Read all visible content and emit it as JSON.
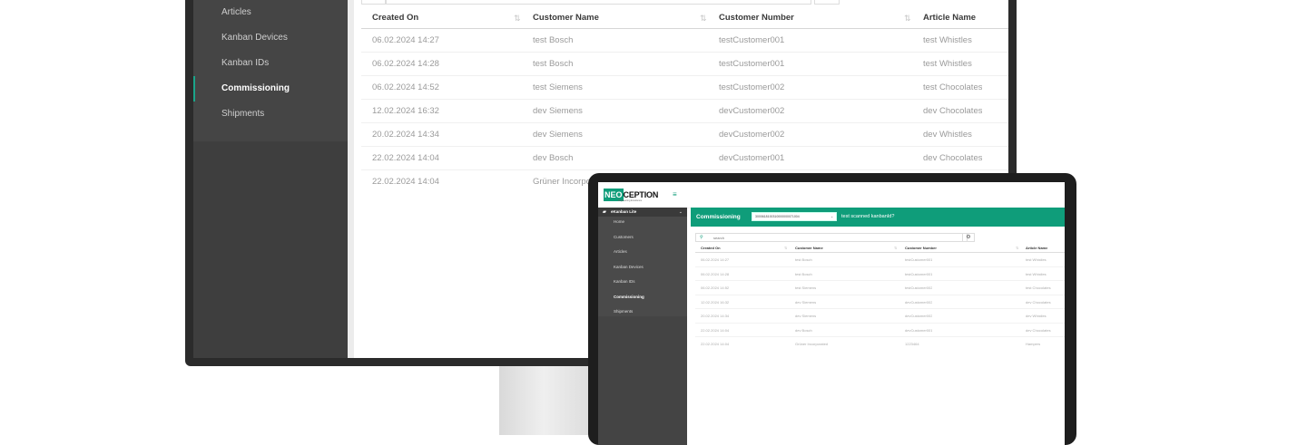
{
  "monitor": {
    "sidebar": {
      "items": [
        {
          "label": "Articles",
          "active": false
        },
        {
          "label": "Kanban Devices",
          "active": false
        },
        {
          "label": "Kanban IDs",
          "active": false
        },
        {
          "label": "Commissioning",
          "active": true
        },
        {
          "label": "Shipments",
          "active": false
        }
      ]
    },
    "table": {
      "columns": [
        "Created On",
        "Customer Name",
        "Customer Number",
        "Article Name"
      ],
      "rows": [
        [
          "06.02.2024 14:27",
          "test Bosch",
          "testCustomer001",
          "test Whistles"
        ],
        [
          "06.02.2024 14:28",
          "test Bosch",
          "testCustomer001",
          "test Whistles"
        ],
        [
          "06.02.2024 14:52",
          "test Siemens",
          "testCustomer002",
          "test Chocolates"
        ],
        [
          "12.02.2024 16:32",
          "dev Siemens",
          "devCustomer002",
          "dev Chocolates"
        ],
        [
          "20.02.2024 14:34",
          "dev Siemens",
          "devCustomer002",
          "dev Whistles"
        ],
        [
          "22.02.2024 14:04",
          "dev Bosch",
          "devCustomer001",
          "dev Chocolates"
        ],
        [
          "22.02.2024 14:04",
          "Grüner Incorpora",
          "",
          ""
        ]
      ]
    }
  },
  "tablet": {
    "logo": {
      "neo": "NEO",
      "ception": "CEPTION",
      "tagline": "Engineering Excellence"
    },
    "sidebar": {
      "group": "eKanban Lite",
      "items": [
        {
          "label": "Home",
          "active": false
        },
        {
          "label": "Customers",
          "active": false
        },
        {
          "label": "Articles",
          "active": false
        },
        {
          "label": "Kanban Devices",
          "active": false
        },
        {
          "label": "Kanban IDs",
          "active": false
        },
        {
          "label": "Commissioning",
          "active": true
        },
        {
          "label": "Shipments",
          "active": false
        }
      ]
    },
    "banner": {
      "title": "Commissioning",
      "select_value": "3000618100310000000071004",
      "scan_text": "test scanned kanbanId?"
    },
    "search": {
      "placeholder": "search"
    },
    "table": {
      "columns": [
        "Created On",
        "Customer Name",
        "Customer Number",
        "Article Name"
      ],
      "rows": [
        [
          "06.02.2024 14:27",
          "test Bosch",
          "testCustomer001",
          "test Whistles"
        ],
        [
          "06.02.2024 14:28",
          "test Bosch",
          "testCustomer001",
          "test Whistles"
        ],
        [
          "06.02.2024 14:52",
          "test Siemens",
          "testCustomer002",
          "test Chocolates"
        ],
        [
          "12.02.2024 16:32",
          "dev Siemens",
          "devCustomer002",
          "dev Chocolates"
        ],
        [
          "20.02.2024 14:34",
          "dev Siemens",
          "devCustomer002",
          "dev Whistles"
        ],
        [
          "22.02.2024 14:04",
          "dev Bosch",
          "devCustomer001",
          "dev Chocolates"
        ],
        [
          "22.02.2024 14:04",
          "Grüner Incorporated",
          "1223464",
          "Hampers"
        ]
      ]
    }
  },
  "colors": {
    "accent": "#0f9d7a",
    "sidebar": "#444444",
    "frame": "#1e1e1e"
  }
}
